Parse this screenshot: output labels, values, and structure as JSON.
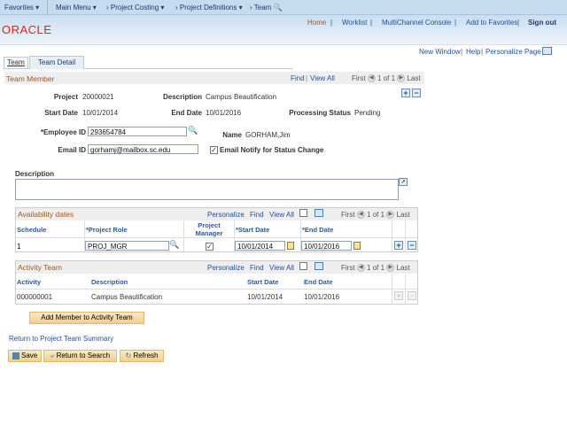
{
  "nav": {
    "favorites": "Favorites",
    "main_menu": "Main Menu",
    "crumbs": [
      "Project Costing",
      "Project Definitions",
      "Team"
    ]
  },
  "header": {
    "links": [
      "Home",
      "Worklist",
      "MultiChannel Console",
      "Add to Favorites"
    ],
    "signout": "Sign out",
    "logo": "ORACLE"
  },
  "pagelinks": {
    "new_window": "New Window",
    "help": "Help",
    "personalize": "Personalize Page"
  },
  "tabs": [
    {
      "label": "Team"
    },
    {
      "label": "Team Detail",
      "active": true
    }
  ],
  "team_member": {
    "title": "Team Member",
    "find": "Find",
    "view_all": "View All",
    "first": "First",
    "count": "1 of 1",
    "last": "Last",
    "project_label": "Project",
    "project": "20000021",
    "description_label": "Description",
    "description": "Campus Beautification",
    "start_label": "Start Date",
    "start": "10/01/2014",
    "end_label": "End Date",
    "end": "10/01/2016",
    "status_label": "Processing Status",
    "status": "Pending",
    "employee_label": "*Employee ID",
    "employee_id": "293654784",
    "name_label": "Name",
    "name": "GORHAM,Jim",
    "email_label": "Email ID",
    "email": "gorhamj@mailbox.sc.edu",
    "notify_label": "Email Notify for Status Change",
    "notify": true,
    "desc_label": "Description",
    "desc_value": ""
  },
  "availability": {
    "title": "Availability dates",
    "personalize": "Personalize",
    "find": "Find",
    "view_all": "View All",
    "first": "First",
    "count": "1 of 1",
    "last": "Last",
    "columns": [
      "Schedule",
      "*Project Role",
      "Project Manager",
      "*Start Date",
      "*End Date"
    ],
    "rows": [
      {
        "schedule": "1",
        "role": "PROJ_MGR",
        "manager": true,
        "start": "10/01/2014",
        "end": "10/01/2016"
      }
    ]
  },
  "activity": {
    "title": "Activity Team",
    "personalize": "Personalize",
    "find": "Find",
    "view_all": "View All",
    "first": "First",
    "count": "1 of 1",
    "last": "Last",
    "columns": [
      "Activity",
      "Description",
      "Start Date",
      "End Date"
    ],
    "rows": [
      {
        "activity": "000000001",
        "description": "Campus Beautification",
        "start": "10/01/2014",
        "end": "10/01/2016"
      }
    ]
  },
  "add_member": "Add Member to Activity Team",
  "return_link": "Return to Project Team Summary",
  "buttons": {
    "save": "Save",
    "return_search": "Return to Search",
    "refresh": "Refresh"
  },
  "colors": {
    "logo": "#e0201b",
    "group_title": "#9a5a1e",
    "link": "#1f4f9a",
    "button": "#f1cf8e"
  }
}
